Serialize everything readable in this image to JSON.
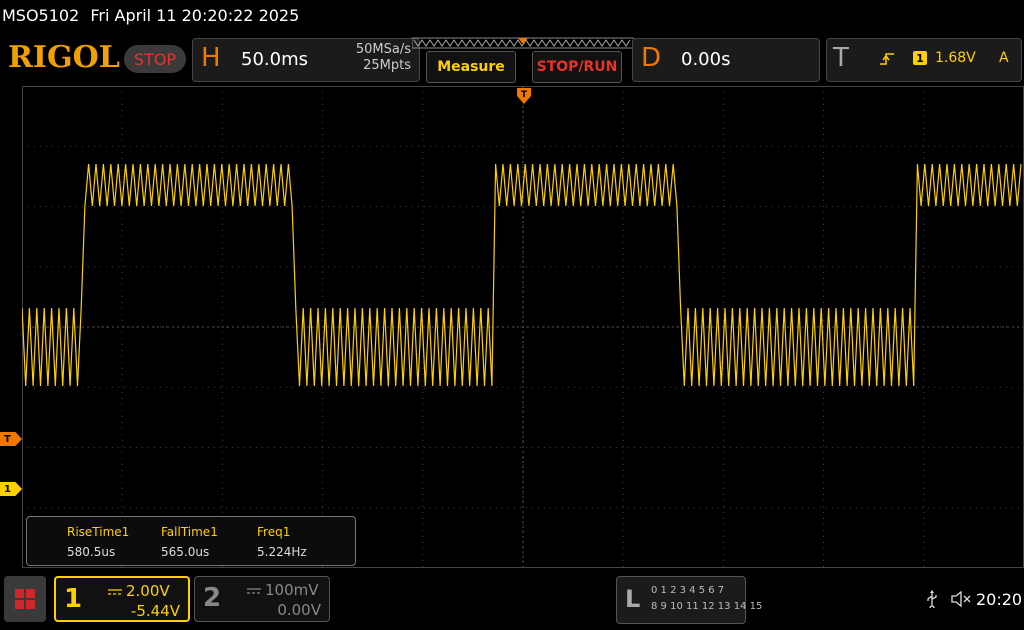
{
  "header": {
    "model": "MSO5102",
    "datetime": "Fri April 11 20:20:22 2025",
    "logo": "RIGOL",
    "run_state": "STOP"
  },
  "horizontal": {
    "label": "H",
    "timebase": "50.0ms",
    "sample_rate": "50MSa/s",
    "memory_depth": "25Mpts"
  },
  "buttons": {
    "measure": "Measure",
    "stop_run": "STOP/RUN"
  },
  "delay": {
    "label": "D",
    "value": "0.00s"
  },
  "trigger": {
    "label": "T",
    "source": "1",
    "level": "1.68V",
    "mode": "A"
  },
  "markers": {
    "trigger": "T",
    "channel1": "1"
  },
  "measurements": [
    {
      "name": "RiseTime1",
      "value": "580.5us"
    },
    {
      "name": "FallTime1",
      "value": "565.0us"
    },
    {
      "name": "Freq1",
      "value": "5.224Hz"
    }
  ],
  "channels": {
    "ch1": {
      "number": "1",
      "scale": "2.00V",
      "offset": "-5.44V",
      "color": "#ffd000"
    },
    "ch2": {
      "number": "2",
      "scale": "100mV",
      "offset": "0.00V",
      "color": "#888888"
    }
  },
  "logic": {
    "label": "L",
    "row1": "0 1 2 3  4 5 6 7",
    "row2": "8 9 10 11 12 13 14 15"
  },
  "status": {
    "clock": "20:20"
  },
  "waveform": {
    "color": "#ffd000",
    "high_segments_fraction_of_screen": [
      [
        0.06,
        0.27
      ],
      [
        0.47,
        0.655
      ],
      [
        0.89,
        1.0
      ]
    ]
  }
}
